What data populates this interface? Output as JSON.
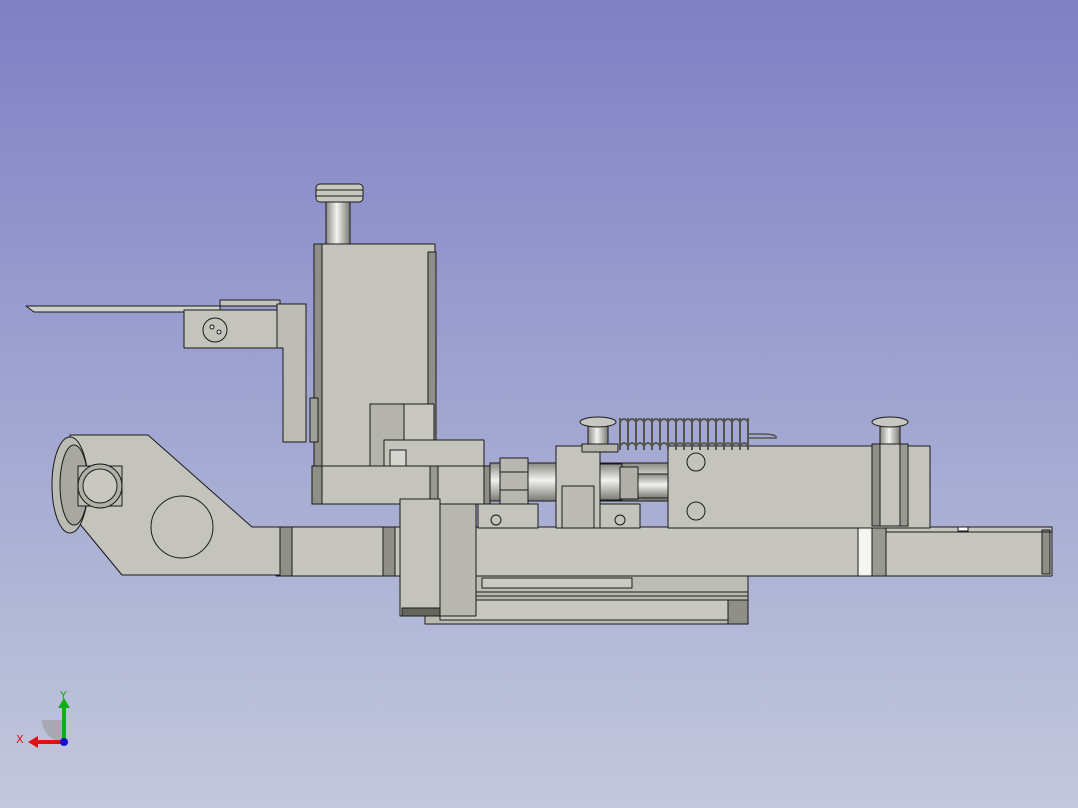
{
  "viewer": {
    "background_top": "#7f7fc4",
    "background_bottom": "#c3c8dc"
  },
  "model": {
    "part_fill": "#c4c4bd",
    "part_shade": "#8f8f88",
    "part_dark": "#66665f",
    "edge_color": "#1a1a1a"
  },
  "axis": {
    "x_label": "X",
    "y_label": "Y",
    "x_color": "#e01010",
    "y_color": "#10b010",
    "z_color": "#1010d0",
    "icons": [
      "x-axis-arrow-icon",
      "y-axis-arrow-icon",
      "z-axis-dot-icon"
    ]
  }
}
